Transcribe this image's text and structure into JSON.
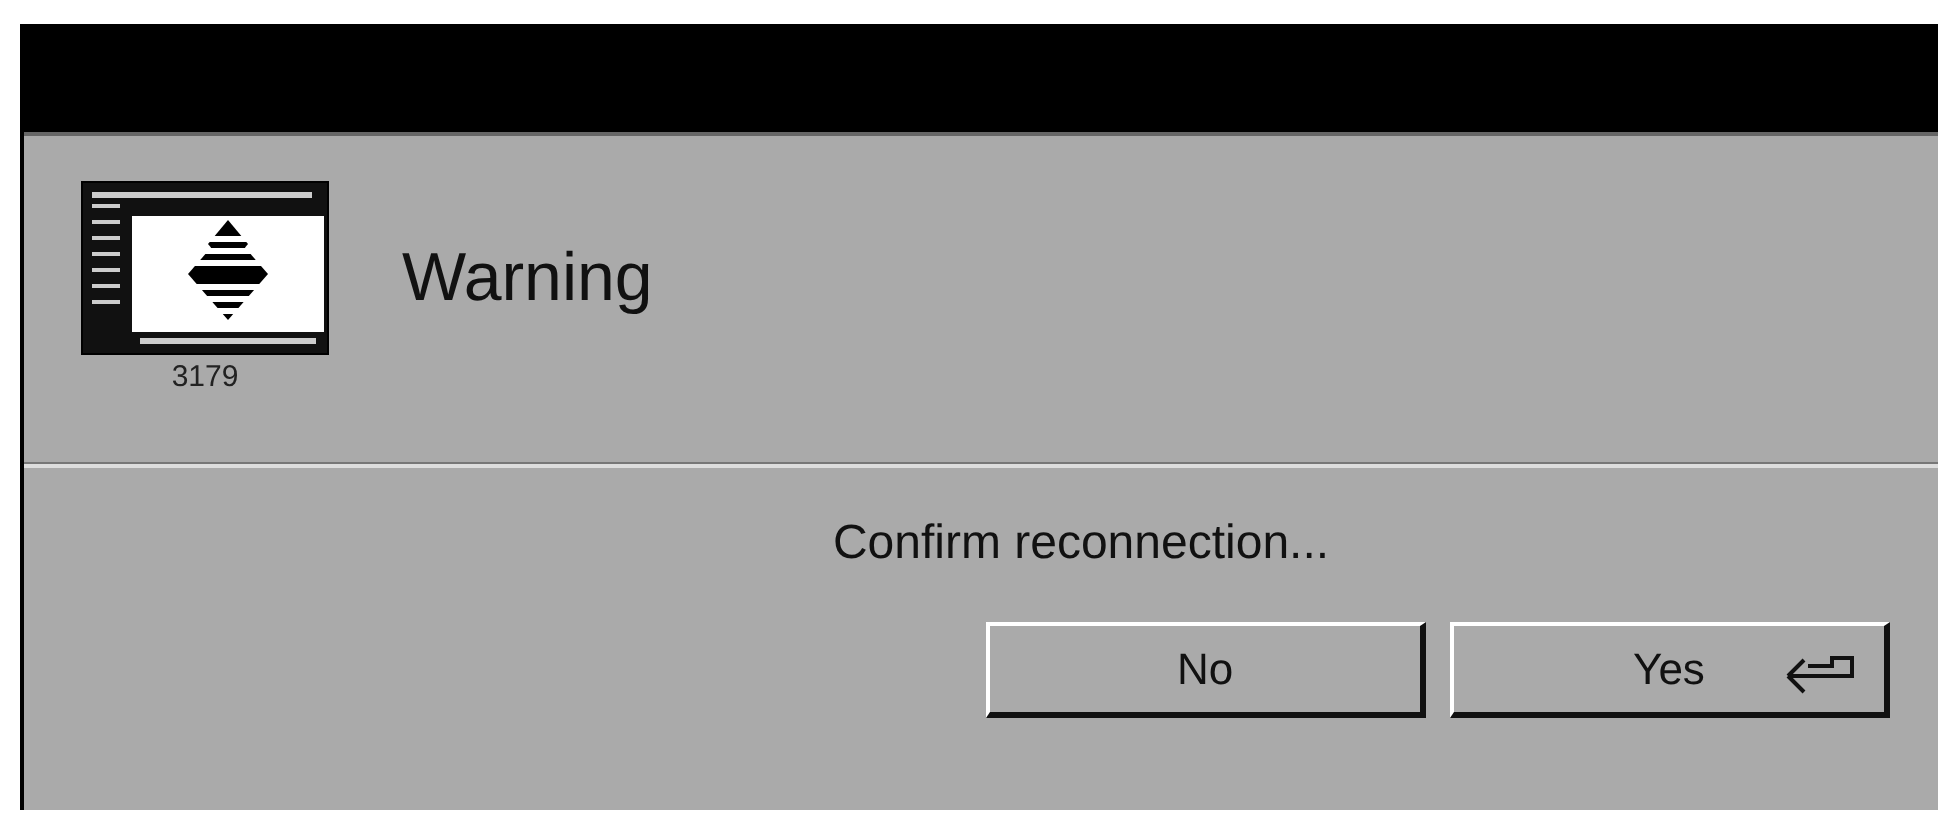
{
  "header": {
    "icon_caption": "3179",
    "title": "Warning"
  },
  "message": "Confirm reconnection...",
  "buttons": [
    {
      "label": "No",
      "default": false
    },
    {
      "label": "Yes",
      "default": true
    }
  ]
}
